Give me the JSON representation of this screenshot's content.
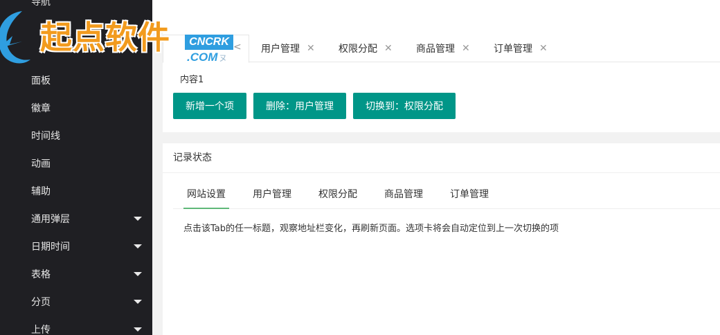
{
  "sidebar": {
    "top_partial": "导航",
    "items": [
      {
        "label": "面板",
        "has_caret": false
      },
      {
        "label": "徽章",
        "has_caret": false
      },
      {
        "label": "时间线",
        "has_caret": false
      },
      {
        "label": "动画",
        "has_caret": false
      },
      {
        "label": "辅助",
        "has_caret": false
      },
      {
        "label": "通用弹层",
        "has_caret": true
      },
      {
        "label": "日期时间",
        "has_caret": true
      },
      {
        "label": "表格",
        "has_caret": true
      },
      {
        "label": "分页",
        "has_caret": true
      },
      {
        "label": "上传",
        "has_caret": true
      }
    ]
  },
  "logo": {
    "cn": "起点软件",
    "en_top": "CNCRK",
    "en_bottom": ".COM",
    "mark": "ヌ",
    "colors": {
      "orange": "#f29b1e",
      "blue": "#2f9ee0"
    }
  },
  "tabs_card": {
    "prev_arrow": "<",
    "tabs": [
      {
        "label": "用户管理",
        "close": "✕"
      },
      {
        "label": "权限分配",
        "close": "✕"
      },
      {
        "label": "商品管理",
        "close": "✕"
      },
      {
        "label": "订单管理",
        "close": "✕"
      }
    ],
    "content": "内容1",
    "buttons": {
      "add": "新增一个项",
      "delete": "删除：用户管理",
      "switch": "切换到：权限分配"
    },
    "button_color": "#009688"
  },
  "record_card": {
    "title": "记录状态",
    "tabs": [
      {
        "label": "网站设置",
        "active": true
      },
      {
        "label": "用户管理",
        "active": false
      },
      {
        "label": "权限分配",
        "active": false
      },
      {
        "label": "商品管理",
        "active": false
      },
      {
        "label": "订单管理",
        "active": false
      }
    ],
    "description": "点击该Tab的任一标题，观察地址栏变化，再刷新页面。选项卡将会自动定位到上一次切换的项",
    "active_color": "#5fb878"
  }
}
